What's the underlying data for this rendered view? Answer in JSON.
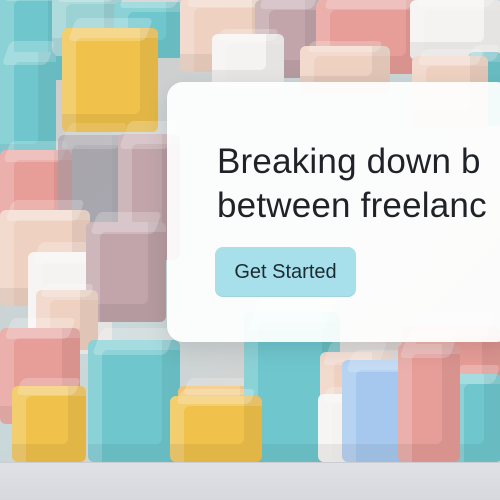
{
  "hero": {
    "headline_line_1": "Breaking down b",
    "headline_line_2": "between freelanc",
    "cta_label": "Get Started"
  }
}
